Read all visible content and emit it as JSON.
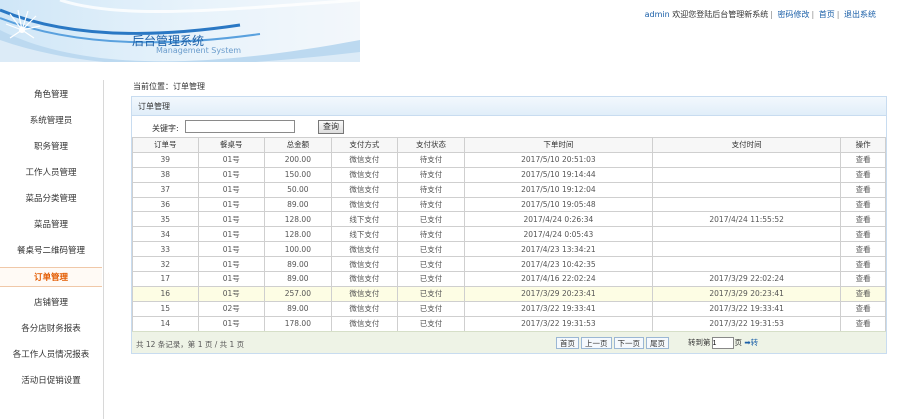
{
  "header": {
    "title": "后台管理系统",
    "subtitle": "Management System",
    "user": "admin",
    "welcome": "欢迎您登陆后台管理新系统",
    "links": [
      "密码修改",
      "首页",
      "退出系统"
    ]
  },
  "sidebar": {
    "items": [
      {
        "label": "角色管理"
      },
      {
        "label": "系统管理员"
      },
      {
        "label": "职务管理"
      },
      {
        "label": "工作人员管理"
      },
      {
        "label": "菜品分类管理"
      },
      {
        "label": "菜品管理"
      },
      {
        "label": "餐桌号二维码管理"
      },
      {
        "label": "订单管理"
      },
      {
        "label": "店铺管理"
      },
      {
        "label": "各分店财务报表"
      },
      {
        "label": "各工作人员情况报表"
      },
      {
        "label": "活动日促销设置"
      }
    ],
    "active_index": 7
  },
  "breadcrumb": "当前位置：订单管理",
  "panel": {
    "title": "订单管理",
    "search_label": "关键字:",
    "search_value": "",
    "search_button": "查询"
  },
  "table": {
    "columns": [
      "订单号",
      "餐桌号",
      "总金额",
      "支付方式",
      "支付状态",
      "下单时间",
      "支付时间",
      "操作"
    ],
    "rows": [
      [
        "39",
        "01号",
        "200.00",
        "微信支付",
        "待支付",
        "2017/5/10 20:51:03",
        "",
        "查看"
      ],
      [
        "38",
        "01号",
        "150.00",
        "微信支付",
        "待支付",
        "2017/5/10 19:14:44",
        "",
        "查看"
      ],
      [
        "37",
        "01号",
        "50.00",
        "微信支付",
        "待支付",
        "2017/5/10 19:12:04",
        "",
        "查看"
      ],
      [
        "36",
        "01号",
        "89.00",
        "微信支付",
        "待支付",
        "2017/5/10 19:05:48",
        "",
        "查看"
      ],
      [
        "35",
        "01号",
        "128.00",
        "线下支付",
        "已支付",
        "2017/4/24 0:26:34",
        "2017/4/24 11:55:52",
        "查看"
      ],
      [
        "34",
        "01号",
        "128.00",
        "线下支付",
        "待支付",
        "2017/4/24 0:05:43",
        "",
        "查看"
      ],
      [
        "33",
        "01号",
        "100.00",
        "微信支付",
        "已支付",
        "2017/4/23 13:34:21",
        "",
        "查看"
      ],
      [
        "32",
        "01号",
        "89.00",
        "微信支付",
        "已支付",
        "2017/4/23 10:42:35",
        "",
        "查看"
      ],
      [
        "17",
        "01号",
        "89.00",
        "微信支付",
        "已支付",
        "2017/4/16 22:02:24",
        "2017/3/29 22:02:24",
        "查看"
      ],
      [
        "16",
        "01号",
        "257.00",
        "微信支付",
        "已支付",
        "2017/3/29 20:23:41",
        "2017/3/29 20:23:41",
        "查看"
      ],
      [
        "15",
        "02号",
        "89.00",
        "微信支付",
        "已支付",
        "2017/3/22 19:33:41",
        "2017/3/22 19:33:41",
        "查看"
      ],
      [
        "14",
        "01号",
        "178.00",
        "微信支付",
        "已支付",
        "2017/3/22 19:31:53",
        "2017/3/22 19:31:53",
        "查看"
      ]
    ],
    "highlight_row": 9
  },
  "pagination": {
    "summary": "共 12 条记录，第 1 页 / 共 1 页",
    "buttons": [
      "首页",
      "上一页",
      "下一页",
      "尾页"
    ],
    "goto_prefix": "转到第",
    "goto_value": "1",
    "goto_suffix": "页",
    "go_label": "➡转"
  },
  "colors": {
    "accent": "#1a5fa8",
    "active_menu": "#e35b00",
    "unpaid": "#d40000",
    "highlight_row": "#fdfde4"
  }
}
